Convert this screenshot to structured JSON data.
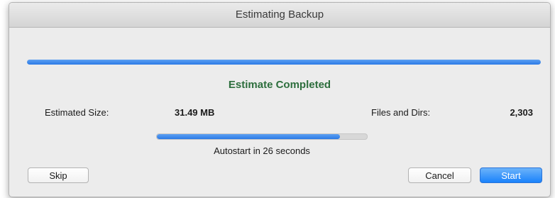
{
  "window": {
    "title": "Estimating Backup"
  },
  "estimate": {
    "progress": 1.0,
    "status": "Estimate Completed",
    "size_label": "Estimated Size:",
    "size_value": "31.49 MB",
    "files_label": "Files and Dirs:",
    "files_value": "2,303"
  },
  "autostart": {
    "progress": 0.87,
    "text": "Autostart in 26 seconds"
  },
  "buttons": {
    "skip": "Skip",
    "cancel": "Cancel",
    "start": "Start"
  },
  "colors": {
    "accent": "#2b7ae6",
    "status_text": "#2d6e3d",
    "primary_button": "#1a82fb"
  }
}
